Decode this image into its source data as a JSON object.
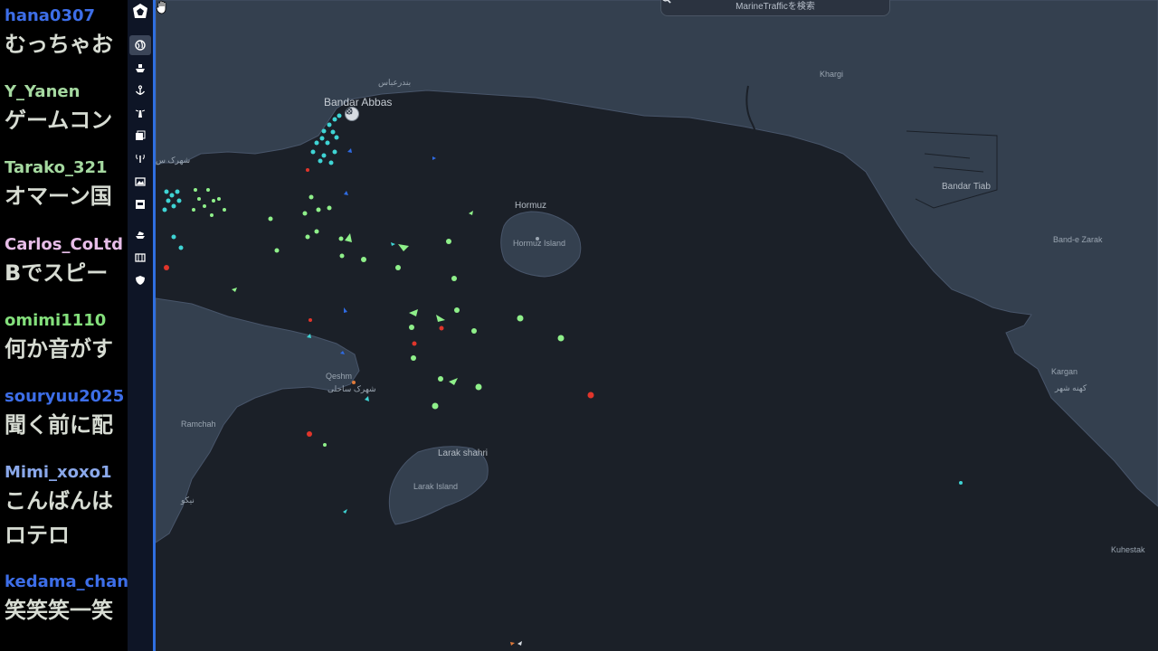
{
  "chat": {
    "messages": [
      {
        "user": "hana0307",
        "user_color": "#3d6ee8",
        "text": "むっちゃお"
      },
      {
        "user": "Y_Yanen",
        "user_color": "#a5d9a0",
        "text": "ゲームコン"
      },
      {
        "user": "Tarako_321",
        "user_color": "#a5d9a0",
        "text": "オマーン国"
      },
      {
        "user": "Carlos_CoLtd",
        "user_color": "#e7bde8",
        "text": "Bでスピー"
      },
      {
        "user": "omimi1110",
        "user_color": "#84e07c",
        "text": "何か音がす"
      },
      {
        "user": "souryuu2025",
        "user_color": "#3d6ee8",
        "text": "聞く前に配"
      },
      {
        "user": "Mimi_xoxo1",
        "user_color": "#8aa8ea",
        "text": "こんばんは",
        "text2": "ロテロ"
      },
      {
        "user": "kedama_chan",
        "user_color": "#3d6ee8",
        "text": "笑笑笑一笑"
      }
    ]
  },
  "search": {
    "placeholder": "MarineTrafficを検索",
    "icon": "search-icon"
  },
  "map": {
    "places": {
      "khargi": "Khargi",
      "bandar_abbas": "Bandar Abbas",
      "bandar_abbas_farsi": "بندرعباس",
      "shahrak": "شهرک س",
      "hormuz": "Hormuz",
      "hormuz_island": "Hormuz Island",
      "bandar_tiab": "Bandar Tiab",
      "band_e_zarak": "Band-e Zarak",
      "qeshm": "Qeshm",
      "qeshm_farsi": "شهرک ساحلی",
      "ramchah": "Ramchah",
      "larak_shahri": "Larak shahri",
      "larak_island": "Larak Island",
      "kargan": "Kargan",
      "kahe_shahr": "کهنه شهر",
      "kuhestak": "Kuhestak",
      "farsi_sw": "نیکو"
    },
    "colors": {
      "land": "#34404f",
      "sea": "#1b2028",
      "coast": "#48556a",
      "cargo": "#8ff08a",
      "tanker": "#e0352b",
      "passenger": "#2f6be3",
      "other": "#3fd4d4"
    }
  },
  "toolbar": {
    "icons": [
      "logo-icon",
      "globe-icon",
      "ship-icon",
      "anchor-icon",
      "lighthouse-icon",
      "layers-icon",
      "antenna-icon",
      "gallery-icon",
      "ship-list-icon",
      "cruise-icon",
      "table-icon",
      "shield-icon"
    ]
  }
}
